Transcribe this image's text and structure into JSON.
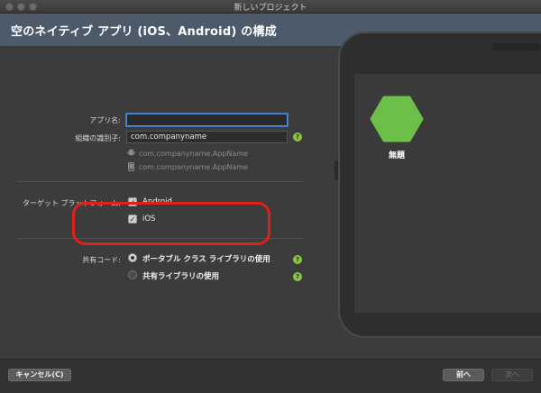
{
  "window": {
    "title": "新しいプロジェクト"
  },
  "header": {
    "title": "空のネイティブ アプリ (iOS、Android) の構成"
  },
  "form": {
    "app_name": {
      "label": "アプリ名:",
      "value": ""
    },
    "org_id": {
      "label": "組織の識別子:",
      "value": "com.companyname",
      "help": "?"
    },
    "bundle_ids": [
      {
        "icon": "android-icon",
        "text": "com.companyname.AppName"
      },
      {
        "icon": "ios-device-icon",
        "text": "com.companyname.AppName"
      }
    ],
    "platforms": {
      "label": "ターゲット プラットフォーム:",
      "items": [
        {
          "label": "Android",
          "checked": true
        },
        {
          "label": "iOS",
          "checked": true
        }
      ]
    },
    "shared_code": {
      "label": "共有コード:",
      "options": [
        {
          "label": "ポータブル クラス ライブラリの使用",
          "selected": true,
          "help": "?"
        },
        {
          "label": "共有ライブラリの使用",
          "selected": false,
          "help": "?"
        }
      ]
    }
  },
  "preview": {
    "app_name": "無題",
    "icon_color": "#6cc04a"
  },
  "footer": {
    "cancel_label": "キャンセル(C)",
    "back_label": "前へ",
    "next_label": "次へ"
  },
  "colors": {
    "highlight": "#e0201a",
    "accent": "#4a90d9",
    "help": "#8bc34a"
  }
}
